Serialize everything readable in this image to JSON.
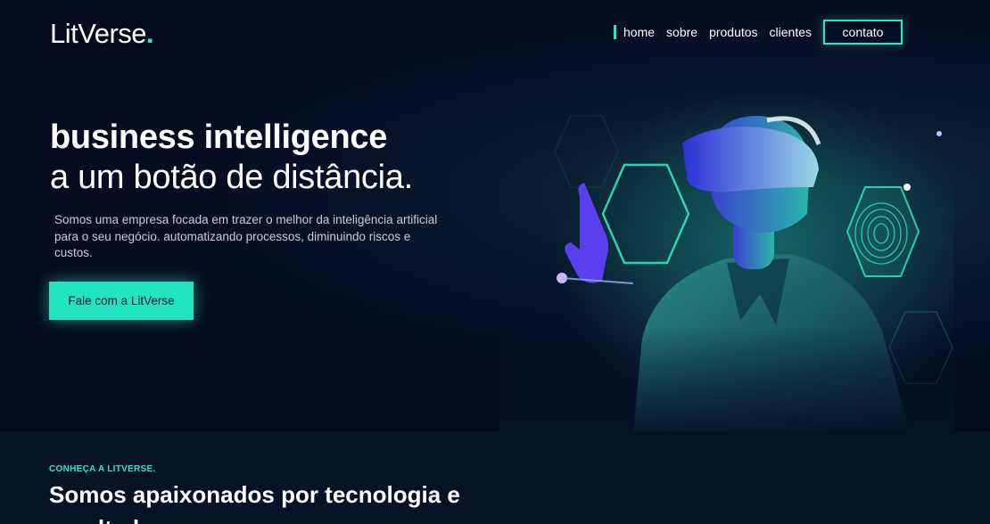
{
  "header": {
    "logo_text": "LitVerse",
    "logo_dot": ".",
    "nav": [
      {
        "label": "home",
        "active": true
      },
      {
        "label": "sobre"
      },
      {
        "label": "produtos"
      },
      {
        "label": "clientes"
      }
    ],
    "contact_label": "contato"
  },
  "hero": {
    "headline": "business intelligence",
    "subhead": "a um botão de distância.",
    "description": "Somos uma empresa focada em trazer o melhor da inteligência artificial para o seu negócio. automatizando processos, diminuindo riscos e custos.",
    "cta_label": "Fale com a LitVerse",
    "image_icon": "vr-headset-illustration"
  },
  "about": {
    "eyebrow": "CONHEÇA A LITVERSE.",
    "title": "Somos apaixonados por tecnologia e resultados."
  },
  "colors": {
    "accent": "#2ee6c4",
    "background": "#06091c",
    "section_bg": "#061327"
  }
}
